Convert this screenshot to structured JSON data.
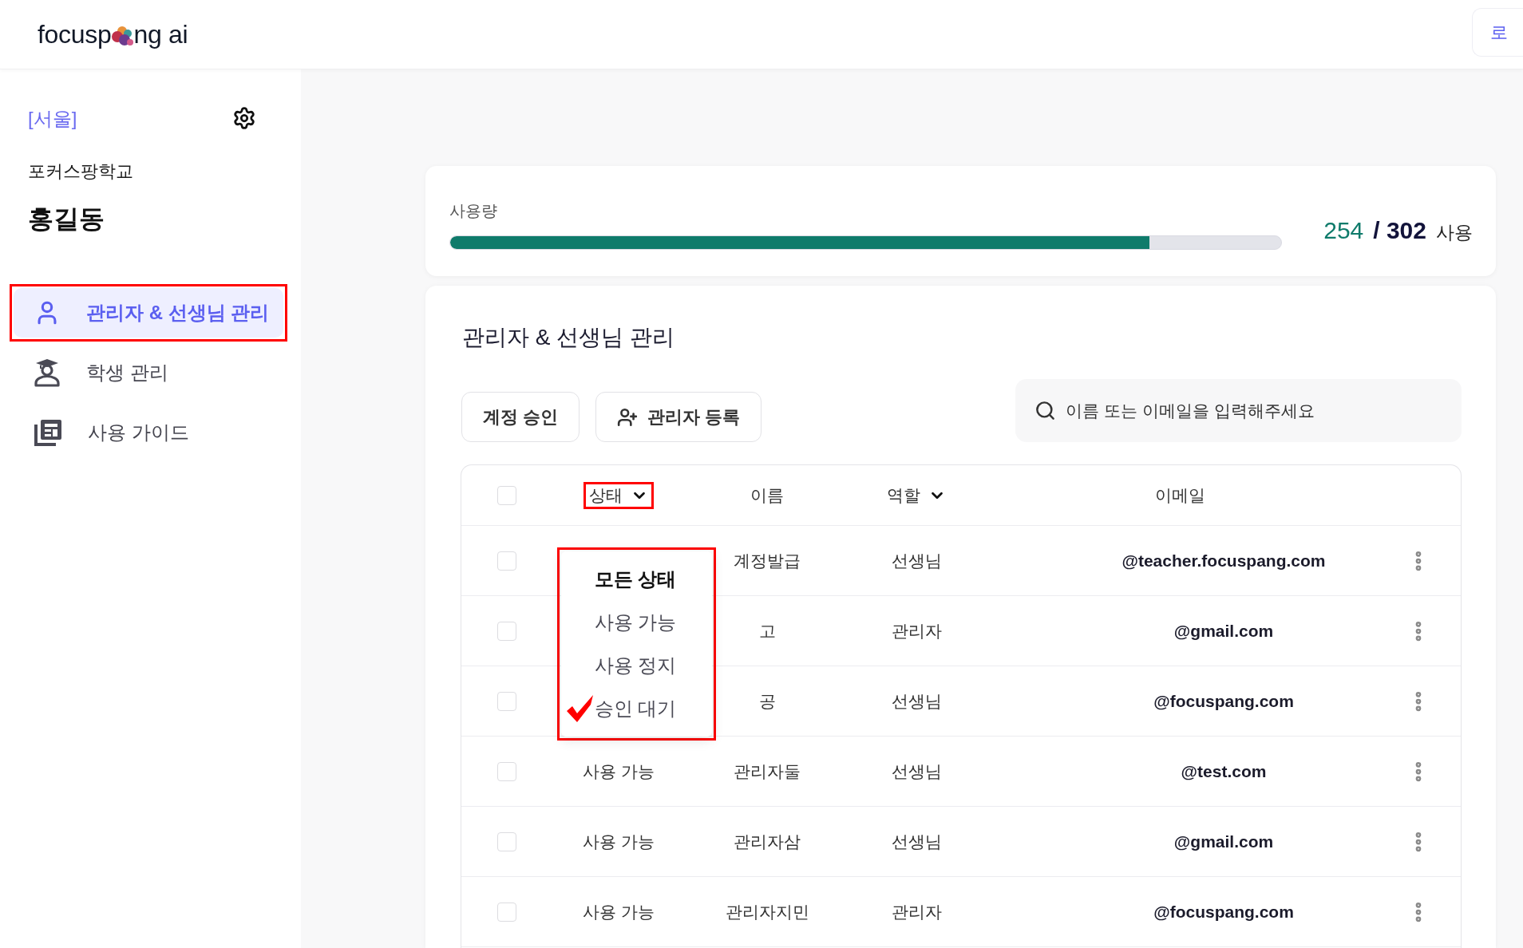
{
  "header": {
    "logo": {
      "text_start": "focusp",
      "text_end": "ng ai"
    },
    "login_button": {
      "label": "로"
    }
  },
  "sidebar": {
    "region": "[서울]",
    "school": "포커스팡학교",
    "user_name": "홍길동",
    "items": [
      {
        "label": "관리자 & 선생님 관리",
        "kind": "user",
        "selected": true,
        "highlighted": true
      },
      {
        "label": "학생 관리",
        "kind": "student",
        "selected": false,
        "highlighted": false
      },
      {
        "label": "사용 가이드",
        "kind": "guide",
        "selected": false,
        "highlighted": false
      }
    ]
  },
  "usage": {
    "label": "사용량",
    "level": 0.841,
    "used": "254",
    "total": "/ 302",
    "unit": "사용"
  },
  "management": {
    "title": "관리자 & 선생님 관리",
    "buttons": [
      {
        "label": "계정 승인",
        "kind": "plain"
      },
      {
        "label": "관리자 등록",
        "kind": "add_admin"
      }
    ],
    "search": {
      "placeholder": "이름 또는 이메일을 입력해주세요"
    },
    "table": {
      "select_all_checked": false,
      "columns": [
        {
          "label": "상태",
          "filter": true,
          "highlighted": true,
          "menu": {
            "highlighted": true,
            "options": [
              {
                "label": "모든 상태",
                "selected": true,
                "marked": false
              },
              {
                "label": "사용 가능",
                "selected": false,
                "marked": false
              },
              {
                "label": "사용 정지",
                "selected": false,
                "marked": false
              },
              {
                "label": "승인 대기",
                "selected": false,
                "marked": true
              }
            ]
          }
        },
        {
          "label": "이름",
          "filter": false,
          "highlighted": false
        },
        {
          "label": "역할",
          "filter": true,
          "highlighted": false
        },
        {
          "label": "이메일",
          "filter": false,
          "highlighted": false
        }
      ],
      "rows": [
        {
          "checked": false,
          "name": "계정발급",
          "role": "선생님",
          "email": "@teacher.focuspang.com"
        },
        {
          "checked": false,
          "name": "고",
          "role": "관리자",
          "email": "@gmail.com"
        },
        {
          "checked": false,
          "name": "공",
          "role": "선생님",
          "email": "@focuspang.com"
        },
        {
          "checked": false,
          "status": "사용 가능",
          "name": "관리자둘",
          "role": "선생님",
          "email": "@test.com"
        },
        {
          "checked": false,
          "status": "사용 가능",
          "name": "관리자삼",
          "role": "선생님",
          "email": "@gmail.com"
        },
        {
          "checked": false,
          "status": "사용 가능",
          "name": "관리자지민",
          "role": "관리자",
          "email": "@focuspang.com"
        }
      ]
    }
  }
}
